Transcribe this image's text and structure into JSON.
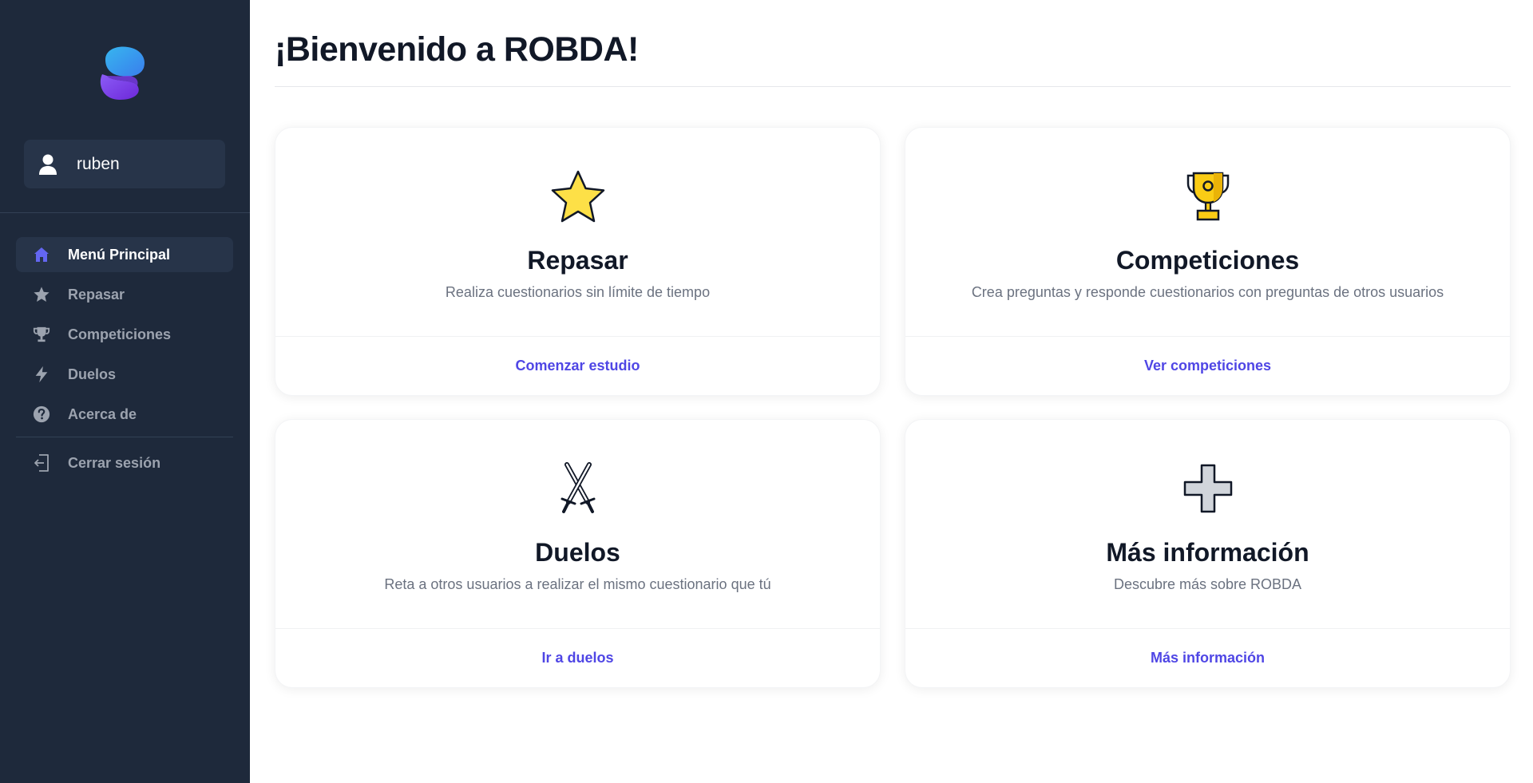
{
  "sidebar": {
    "logo_icon": "app-logo-blob",
    "user": {
      "name": "ruben",
      "icon": "user-icon"
    },
    "nav": [
      {
        "label": "Menú Principal",
        "icon": "home-icon",
        "active": true
      },
      {
        "label": "Repasar",
        "icon": "star-icon",
        "active": false
      },
      {
        "label": "Competiciones",
        "icon": "trophy-icon",
        "active": false
      },
      {
        "label": "Duelos",
        "icon": "bolt-icon",
        "active": false
      },
      {
        "label": "Acerca de",
        "icon": "question-circle-icon",
        "active": false
      }
    ],
    "logout": {
      "label": "Cerrar sesión",
      "icon": "logout-icon"
    }
  },
  "main": {
    "title": "¡Bienvenido a ROBDA!",
    "cards": [
      {
        "title": "Repasar",
        "description": "Realiza cuestionarios sin límite de tiempo",
        "link": "Comenzar estudio",
        "icon": "star-emoji-icon"
      },
      {
        "title": "Competiciones",
        "description": "Crea preguntas y responde cuestionarios con preguntas de otros usuarios",
        "link": "Ver competiciones",
        "icon": "trophy-emoji-icon"
      },
      {
        "title": "Duelos",
        "description": "Reta a otros usuarios a realizar el mismo cuestionario que tú",
        "link": "Ir a duelos",
        "icon": "crossed-swords-icon"
      },
      {
        "title": "Más información",
        "description": "Descubre más sobre ROBDA",
        "link": "Más información",
        "icon": "plus-cross-icon"
      }
    ]
  },
  "colors": {
    "sidebar_bg": "#1e293b",
    "active_item_bg": "#273449",
    "accent": "#4f46e5",
    "muted_text": "#9ca3af"
  }
}
